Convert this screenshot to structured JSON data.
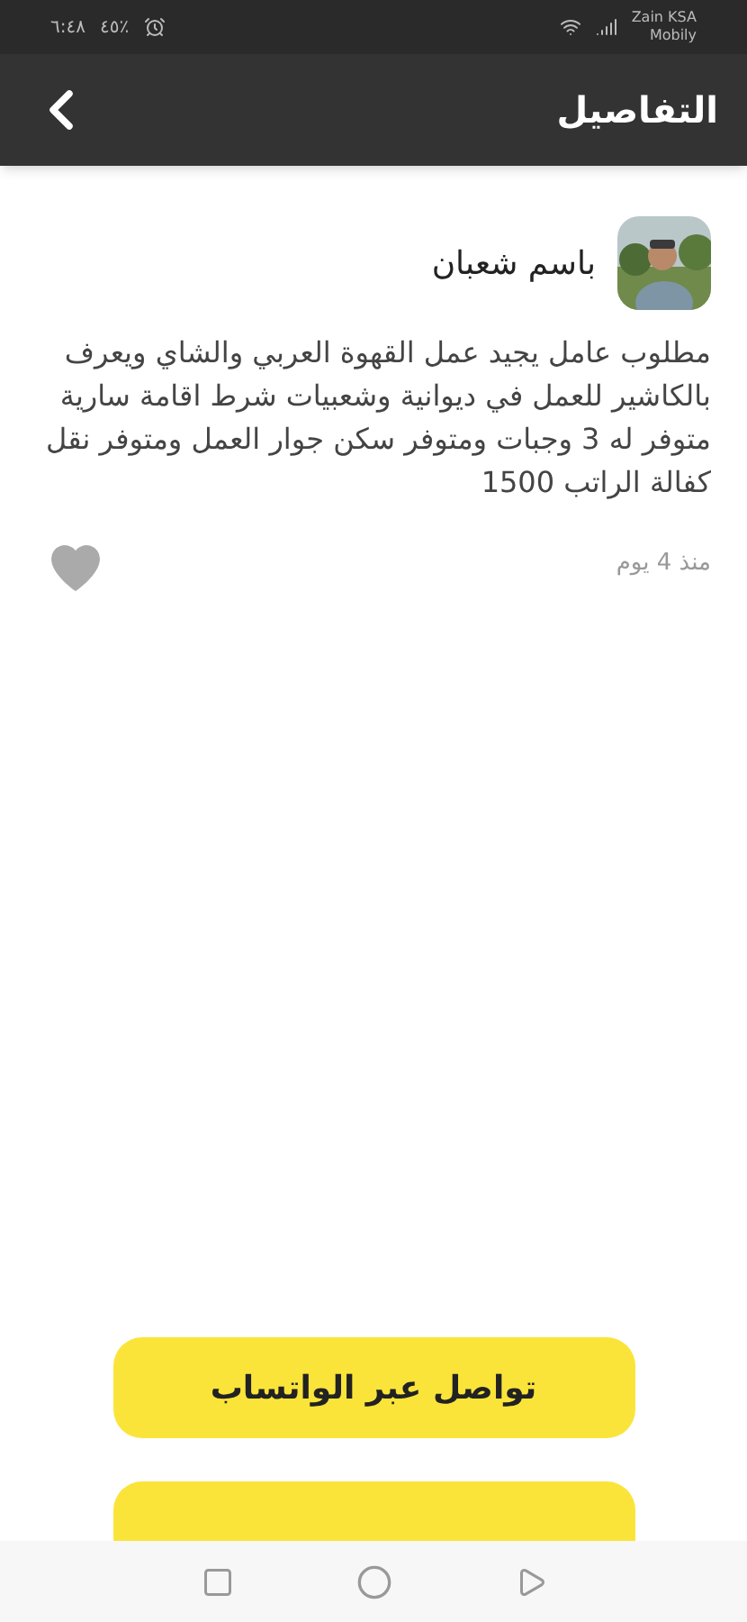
{
  "status_bar": {
    "time": "٦:٤٨",
    "battery": "٤٥٪",
    "carrier": "Zain KSA",
    "carrier_2": "Mobily"
  },
  "header": {
    "title": "التفاصيل"
  },
  "post": {
    "author": "باسم شعبان",
    "body": "مطلوب عامل يجيد عمل القهوة العربي والشاي ويعرف بالكاشير للعمل في ديوانية وشعبيات شرط اقامة سارية متوفر له 3 وجبات ومتوفر سكن جوار العمل ومتوفر نقل كفالة الراتب 1500",
    "time": "منذ 4 يوم",
    "liked": false
  },
  "buttons": [
    {
      "label": "تواصل عبر الواتساب"
    }
  ]
}
